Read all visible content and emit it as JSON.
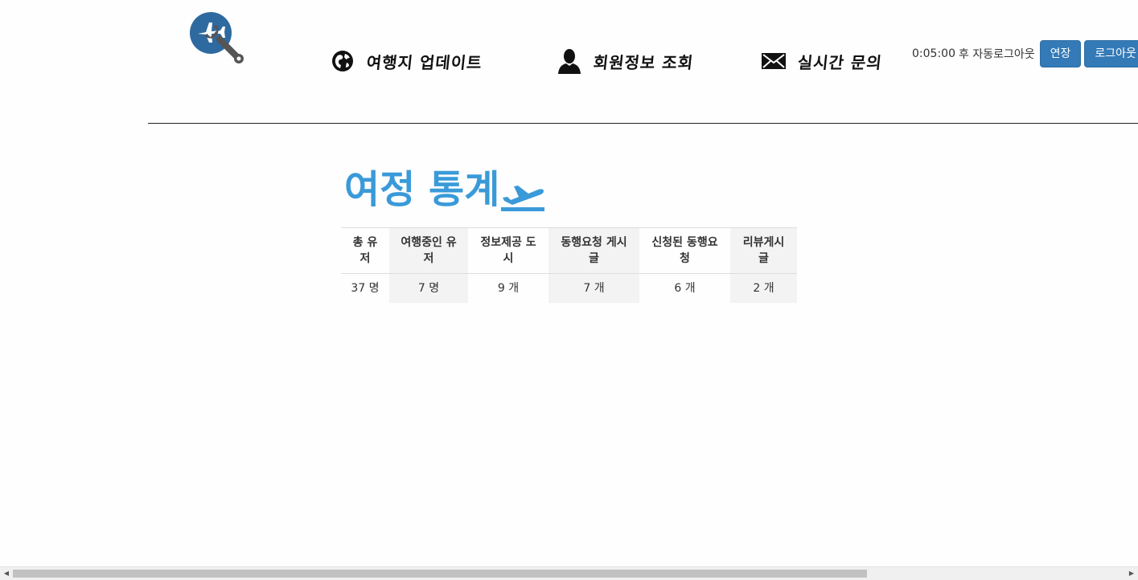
{
  "header": {
    "logo_icon": "plane-wrench-logo",
    "nav": [
      {
        "label": "여행지 업데이트",
        "icon": "globe-icon"
      },
      {
        "label": "회원정보 조회",
        "icon": "user-icon"
      },
      {
        "label": "실시간 문의",
        "icon": "envelope-icon"
      }
    ],
    "session": {
      "timer": "0:05:00",
      "timer_suffix": "후 자동로그아웃",
      "extend_label": "연장",
      "logout_label": "로그아웃"
    }
  },
  "main": {
    "title": "여정 통계",
    "title_icon": "plane-takeoff-icon",
    "stats_table": {
      "headers": [
        "총 유저",
        "여행중인 유저",
        "정보제공 도시",
        "동행요청 게시글",
        "신청된 동행요청",
        "리뷰게시글"
      ],
      "values": [
        "37 명",
        "7 명",
        "9 개",
        "7 개",
        "6 개",
        "2 개"
      ]
    }
  },
  "colors": {
    "accent": "#3a9ad9",
    "button": "#337ab7",
    "logo_blue": "#2e6aa0",
    "logo_gray": "#555555"
  }
}
